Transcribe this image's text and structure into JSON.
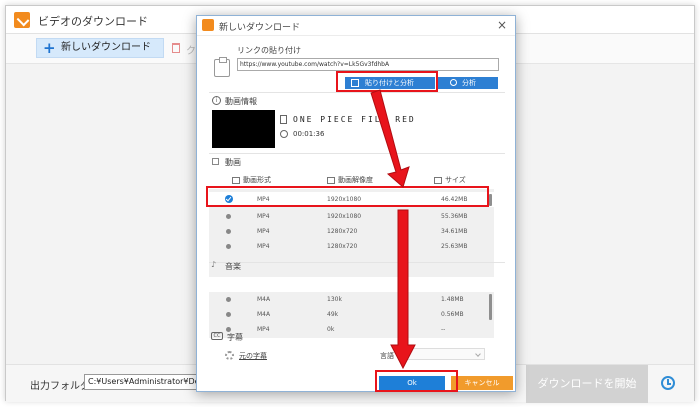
{
  "main": {
    "title": "ビデオのダウンロード",
    "new_download": "新しいダウンロード",
    "clear_partial": "ク",
    "output_label": "出力フォルダ：",
    "output_path": "C:¥Users¥Administrator¥Desktop",
    "download_button": "ダウンロードを開始"
  },
  "dialog": {
    "title": "新しいダウンロード",
    "close_glyph": "×",
    "paste_label": "リンクの貼り付け",
    "url_value": "https://www.youtube.com/watch?v=Lk5Gv3fdhbA",
    "paste_analyze": "貼り付けと分析",
    "analyze": "分析",
    "info_label": "動画情報",
    "video_title": "ONE PIECE FILM RED",
    "duration": "00:01:36",
    "video_section": "動画",
    "columns": {
      "format": "動画形式",
      "resolution": "動画解像度",
      "size": "サイズ"
    },
    "video_rows": [
      {
        "format": "MP4",
        "resolution": "1920x1080",
        "size": "46.42MB",
        "selected": true
      },
      {
        "format": "MP4",
        "resolution": "1920x1080",
        "size": "55.36MB",
        "selected": false
      },
      {
        "format": "MP4",
        "resolution": "1280x720",
        "size": "34.61MB",
        "selected": false
      },
      {
        "format": "MP4",
        "resolution": "1280x720",
        "size": "25.63MB",
        "selected": false
      }
    ],
    "audio_section": "音楽",
    "audio_rows": [
      {
        "format": "M4A",
        "bitrate": "130k",
        "size": "1.48MB"
      },
      {
        "format": "M4A",
        "bitrate": "49k",
        "size": "0.56MB"
      },
      {
        "format": "MP4",
        "bitrate": "0k",
        "size": "--"
      }
    ],
    "subtitle_section": "字幕",
    "subtitle_link": "元の字幕",
    "language_label": "言語",
    "ok": "Ok",
    "cancel": "キャンセル"
  },
  "colors": {
    "accent_blue": "#1e7fd8",
    "cancel_orange": "#f19b2c",
    "annotation_red": "#e8141b"
  }
}
